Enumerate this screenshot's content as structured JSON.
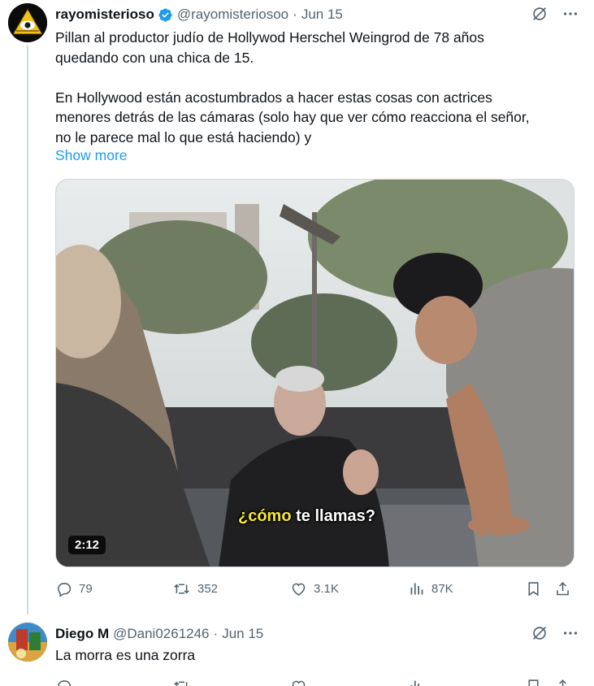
{
  "tweet": {
    "author_name": "rayomisterioso",
    "author_handle": "@rayomisteriosoo",
    "separator": "·",
    "date": "Jun 15",
    "text_lines": [
      "Pillan al productor judío de Hollywod Herschel Weingrod de 78 años",
      "quedando con una chica de 15.",
      "",
      "En Hollywood están acostumbrados a hacer estas cosas con actrices",
      "menores detrás de las cámaras (solo hay que ver cómo reacciona el señor,",
      "no le parece mal lo que está haciendo) y"
    ],
    "show_more": "Show more",
    "video": {
      "duration": "2:12",
      "subtitle_highlight": "¿cómo",
      "subtitle_rest": "te llamas?"
    },
    "stats": {
      "replies": "79",
      "reposts": "352",
      "likes": "3.1K",
      "views": "87K"
    }
  },
  "reply": {
    "author_name": "Diego M",
    "author_handle": "@Dani0261246",
    "separator": "·",
    "date": "Jun 15",
    "text": "La morra es una zorra"
  },
  "colors": {
    "verified": "#1d9bf0",
    "link": "#1d9bf0",
    "secondary_text": "#536471",
    "subtitle_highlight": "#f5e533"
  },
  "icons": [
    "verified-badge-icon",
    "grok-icon",
    "more-icon",
    "reply-icon",
    "repost-icon",
    "like-icon",
    "views-icon",
    "bookmark-icon",
    "share-icon"
  ]
}
